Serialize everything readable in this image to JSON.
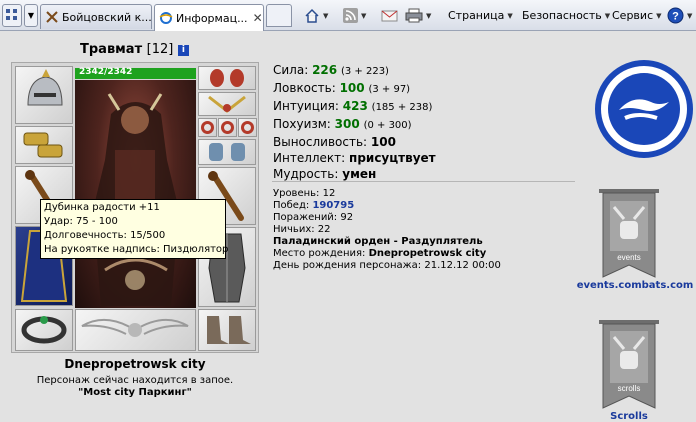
{
  "browser": {
    "tabs": [
      {
        "label": "Бойцовский к..."
      },
      {
        "label": "Информац...",
        "active": true
      }
    ],
    "commands": {
      "page": "Страница",
      "security": "Безопасность",
      "tools": "Сервис"
    }
  },
  "character": {
    "name": "Травмат",
    "level_badge": "[12]",
    "hp": "2342/2342",
    "hp_fraction": 1.0,
    "city": "Dnepropetrowsk city",
    "status": "Персонаж сейчас находится в запое.",
    "location": "\"Most city Паркинг\""
  },
  "tooltip": {
    "lines": [
      "Дубинка радости +11",
      "Удар: 75 - 100",
      "Долговечность: 15/500",
      "На рукоятке надпись: Пиздюлятор"
    ]
  },
  "stats": [
    {
      "label": "Сила:",
      "value": "226",
      "bonus": "(3 + 223)"
    },
    {
      "label": "Ловкость:",
      "value": "100",
      "bonus": "(3 + 97)"
    },
    {
      "label": "Интуиция:",
      "value": "423",
      "bonus": "(185 + 238)"
    },
    {
      "label": "Похуизм:",
      "value": "300",
      "bonus": "(0 + 300)"
    },
    {
      "label": "Выносливость:",
      "value": "100"
    },
    {
      "label": "Интеллект:",
      "value": "присуцтвует"
    },
    {
      "label": "Мудрость:",
      "value": "умен"
    }
  ],
  "info": {
    "level_label": "Уровень:",
    "level": "12",
    "wins_label": "Побед:",
    "wins": "190795",
    "losses_label": "Поражений:",
    "losses": "92",
    "draws_label": "Ничьих:",
    "draws": "22",
    "order": "Паладинский орден - Раздуплятель",
    "birthplace_label": "Место рождения:",
    "birthplace": "Dnepropetrowsk city",
    "birthday_label": "День рождения персонажа:",
    "birthday": "21.12.12 00:00"
  },
  "sidebar": {
    "events_banner_text": "events",
    "events_link": "events.combats.com",
    "scrolls_banner_text": "scrolls",
    "scrolls_link": "Scrolls"
  },
  "colors": {
    "stat_value": "#006f00",
    "link": "#1a3a9c",
    "hp_bar": "#1ea21e",
    "clan_badge": "#1a47b8"
  }
}
